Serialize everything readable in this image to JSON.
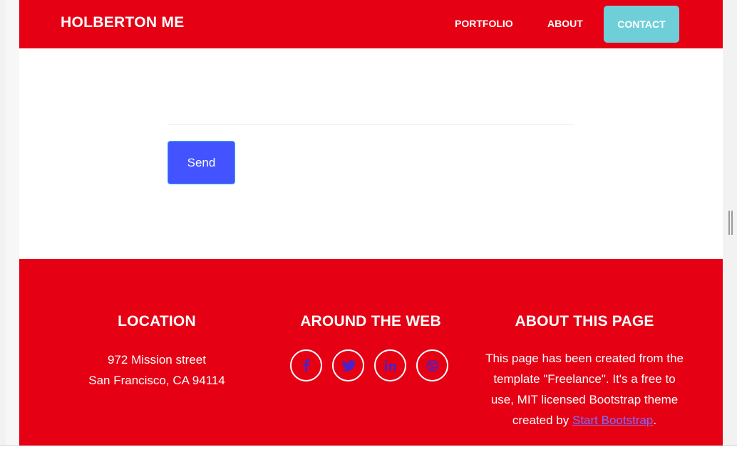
{
  "navbar": {
    "brand": "HOLBERTON ME",
    "links": [
      "PORTFOLIO",
      "ABOUT"
    ],
    "contact": "CONTACT"
  },
  "form": {
    "send_label": "Send"
  },
  "footer": {
    "location": {
      "title": "LOCATION",
      "line1": "972 Mission street",
      "line2": "San Francisco, CA 94114"
    },
    "web": {
      "title": "AROUND THE WEB",
      "icons": [
        "facebook-icon",
        "twitter-icon",
        "linkedin-icon",
        "dribbble-icon"
      ]
    },
    "about": {
      "title": "ABOUT THIS PAGE",
      "text": "This page has been created from the template \"Freelance\". It's a free to use, MIT licensed Bootstrap theme created by",
      "link": "Start Bootstrap",
      "end": "."
    }
  },
  "colors": {
    "primary": "#e50014",
    "accent": "#6ecfd9",
    "button": "#4353ff",
    "icon": "#4b21c9"
  }
}
